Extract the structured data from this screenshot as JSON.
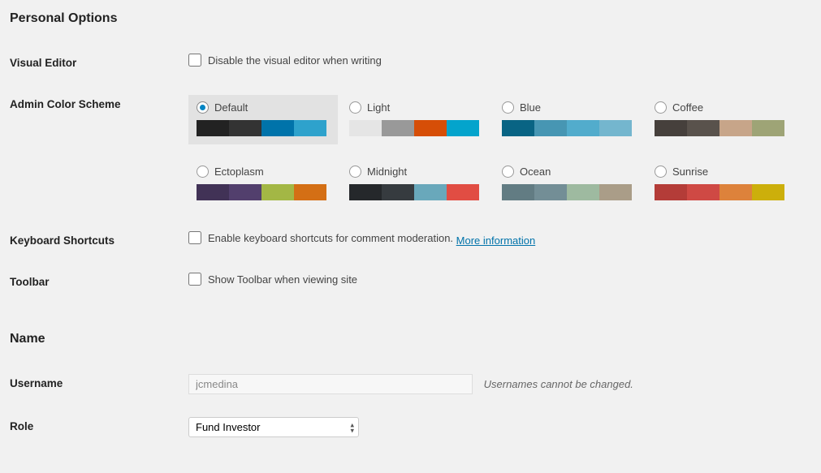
{
  "sections": {
    "personal_options": "Personal Options",
    "name": "Name"
  },
  "visual_editor": {
    "label": "Visual Editor",
    "checkbox_label": "Disable the visual editor when writing"
  },
  "color_scheme": {
    "label": "Admin Color Scheme",
    "selected": "default",
    "schemes": [
      {
        "id": "default",
        "name": "Default",
        "colors": [
          "#222222",
          "#333333",
          "#0073aa",
          "#2ea2cc"
        ]
      },
      {
        "id": "light",
        "name": "Light",
        "colors": [
          "#e5e5e5",
          "#999999",
          "#d64e07",
          "#04a4cc"
        ]
      },
      {
        "id": "blue",
        "name": "Blue",
        "colors": [
          "#096484",
          "#4796b3",
          "#52accc",
          "#74B6CE"
        ]
      },
      {
        "id": "coffee",
        "name": "Coffee",
        "colors": [
          "#46403c",
          "#59524c",
          "#c7a589",
          "#9ea476"
        ]
      },
      {
        "id": "ectoplasm",
        "name": "Ectoplasm",
        "colors": [
          "#413256",
          "#523f6d",
          "#a3b745",
          "#d46f15"
        ]
      },
      {
        "id": "midnight",
        "name": "Midnight",
        "colors": [
          "#25282b",
          "#363b3f",
          "#69a8bb",
          "#e14d43"
        ]
      },
      {
        "id": "ocean",
        "name": "Ocean",
        "colors": [
          "#627c83",
          "#738e96",
          "#9ebaa0",
          "#aa9d88"
        ]
      },
      {
        "id": "sunrise",
        "name": "Sunrise",
        "colors": [
          "#b43c38",
          "#cf4944",
          "#dd823b",
          "#ccaf0b"
        ]
      }
    ]
  },
  "keyboard_shortcuts": {
    "label": "Keyboard Shortcuts",
    "checkbox_label": "Enable keyboard shortcuts for comment moderation.",
    "link_text": "More information"
  },
  "toolbar": {
    "label": "Toolbar",
    "checkbox_label": "Show Toolbar when viewing site"
  },
  "username": {
    "label": "Username",
    "value": "jcmedina",
    "description": "Usernames cannot be changed."
  },
  "role": {
    "label": "Role",
    "value": "Fund Investor"
  }
}
